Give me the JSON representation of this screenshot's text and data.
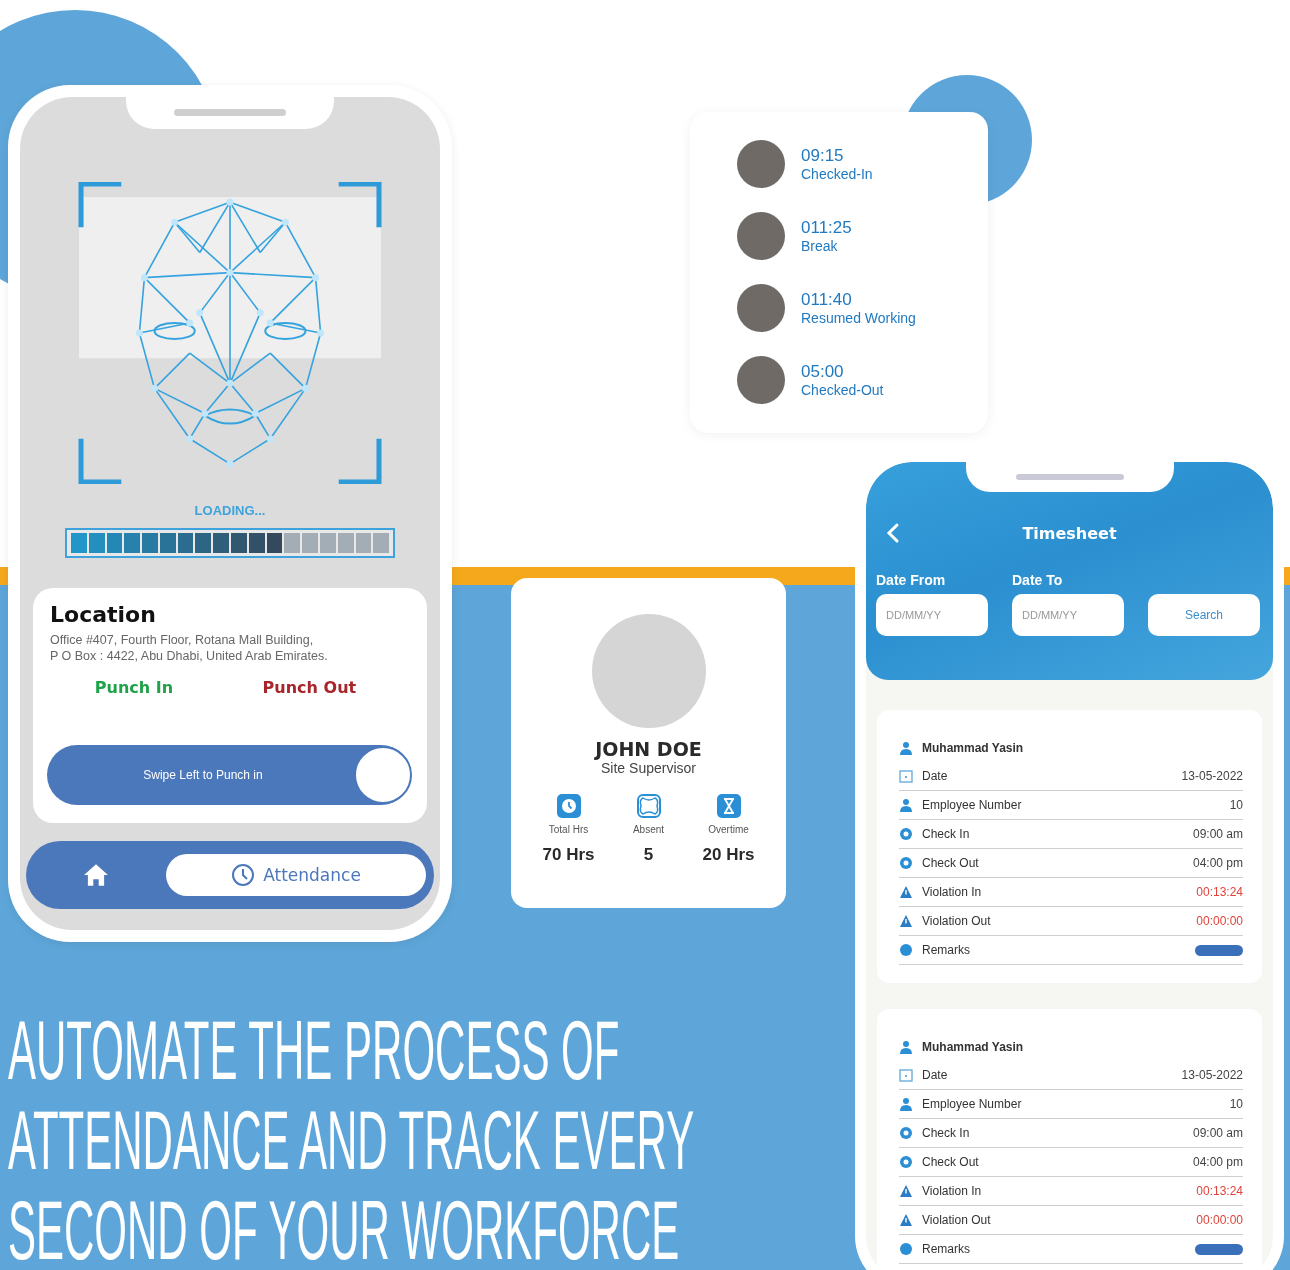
{
  "scan_phone": {
    "status": "LOADING...",
    "loading": {
      "level": 0.667
    },
    "location": {
      "title": "Location",
      "address": "Office #407, Fourth Floor, Rotana Mall Building,\nP O Box : 4422, Abu Dhabi, United Arab Emirates.",
      "punch_in": "Punch In",
      "punch_out": "Punch Out",
      "swipe_label": "Swipe Left to Punch in",
      "swipe": {
        "level": 1
      }
    },
    "nav": [
      {
        "kind": "home",
        "selected": false
      },
      {
        "kind": "attendance",
        "label": "Attendance",
        "selected": true
      }
    ]
  },
  "timeline": [
    {
      "time": "09:15",
      "event": "Checked-In"
    },
    {
      "time": "011:25",
      "event": "Break"
    },
    {
      "time": "011:40",
      "event": "Resumed Working"
    },
    {
      "time": "05:00",
      "event": "Checked-Out"
    }
  ],
  "profile": {
    "name": "JOHN DOE",
    "role": "Site Supervisor",
    "stats": [
      {
        "kind": "clock",
        "label": "Total Hrs",
        "value": "70 Hrs"
      },
      {
        "kind": "absent",
        "label": "Absent",
        "value": "5"
      },
      {
        "kind": "hourglass",
        "label": "Overtime",
        "value": "20 Hrs"
      }
    ]
  },
  "timesheet": {
    "title": "Timesheet",
    "date_from": {
      "label": "Date From",
      "placeholder": "DD/MM/YY"
    },
    "date_to": {
      "label": "Date To",
      "placeholder": "DD/MM/YY"
    },
    "search_button": "Search",
    "records": [
      {
        "rows": [
          {
            "kind": "name",
            "label": "Muhammad Yasin"
          },
          {
            "kind": "date",
            "label": "Date",
            "value": "13-05-2022"
          },
          {
            "kind": "employee",
            "label": "Employee Number",
            "value": "10"
          },
          {
            "kind": "time",
            "label": "Check In",
            "value": "09:00 am"
          },
          {
            "kind": "time",
            "label": "Check Out",
            "value": "04:00 pm"
          },
          {
            "kind": "violation",
            "label": "Violation In",
            "value": "00:13:24"
          },
          {
            "kind": "violation",
            "label": "Violation Out",
            "value": "00:00:00"
          },
          {
            "kind": "remarks",
            "label": "Remarks"
          }
        ]
      },
      {
        "rows": [
          {
            "kind": "name",
            "label": "Muhammad Yasin"
          },
          {
            "kind": "date",
            "label": "Date",
            "value": "13-05-2022"
          },
          {
            "kind": "employee",
            "label": "Employee Number",
            "value": "10"
          },
          {
            "kind": "time",
            "label": "Check In",
            "value": "09:00 am"
          },
          {
            "kind": "time",
            "label": "Check Out",
            "value": "04:00 pm"
          },
          {
            "kind": "violation",
            "label": "Violation In",
            "value": "00:13:24"
          },
          {
            "kind": "violation",
            "label": "Violation Out",
            "value": "00:00:00"
          },
          {
            "kind": "remarks",
            "label": "Remarks"
          }
        ]
      }
    ]
  },
  "headline_lines": [
    "AUTOMATE THE PROCESS OF",
    "ATTENDANCE AND TRACK EVERY",
    "SECOND OF YOUR WORKFORCE"
  ]
}
